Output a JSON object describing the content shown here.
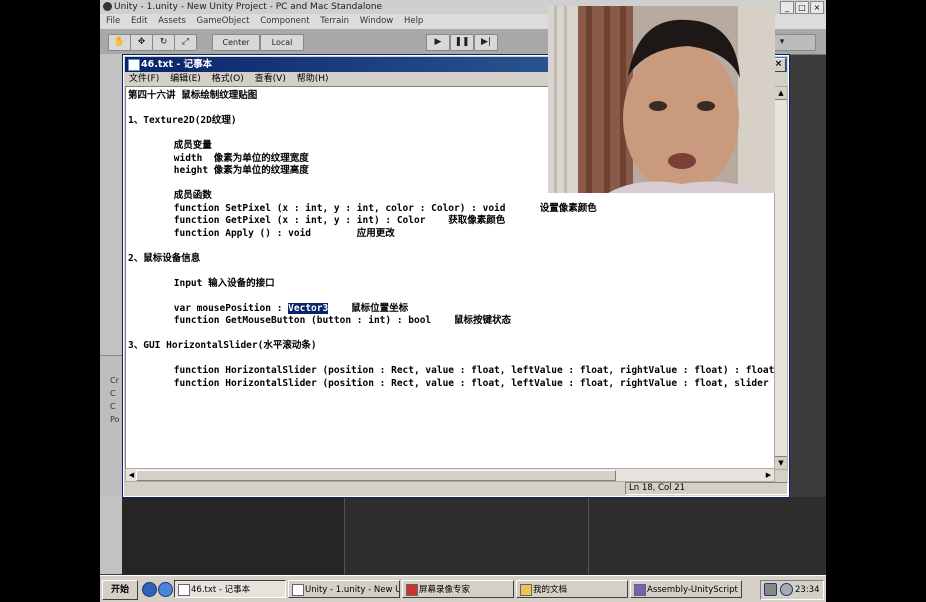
{
  "unity": {
    "title": "Unity - 1.unity - New Unity Project - PC and Mac Standalone",
    "menu": [
      "File",
      "Edit",
      "Assets",
      "GameObject",
      "Component",
      "Terrain",
      "Window",
      "Help"
    ],
    "pivot_center": "Center",
    "pivot_local": "Local",
    "left_panel_labels": [
      "Cr",
      "C",
      "C",
      "Po"
    ]
  },
  "notepad": {
    "title": "46.txt - 记事本",
    "menu": [
      "文件(F)",
      "编辑(E)",
      "格式(O)",
      "查看(V)",
      "帮助(H)"
    ],
    "lines": [
      "第四十六讲 鼠标绘制纹理贴图",
      "",
      "1、Texture2D(2D纹理)",
      "",
      "        成员变量",
      "        width  像素为单位的纹理宽度",
      "        height 像素为单位的纹理高度",
      "",
      "        成员函数",
      "        function SetPixel (x : int, y : int, color : Color) : void      设置像素颜色",
      "        function GetPixel (x : int, y : int) : Color    获取像素颜色",
      "        function Apply () : void        应用更改",
      "",
      "2、鼠标设备信息",
      "",
      "        Input 输入设备的接口",
      "",
      "        var mousePosition : ",
      "        function GetMouseButton (button : int) : bool    鼠标按键状态",
      "",
      "3、GUI HorizontalSlider(水平滚动条)",
      "",
      "        function HorizontalSlider (position : Rect, value : float, leftValue : float, rightValue : float) : float",
      "        function HorizontalSlider (position : Rect, value : float, leftValue : float, rightValue : float, slider :"
    ],
    "selected_text": "Vector3",
    "after_selection": "    鼠标位置坐标",
    "status": "Ln 18, Col 21"
  },
  "taskbar": {
    "start": "开始",
    "tasks": [
      "46.txt - 记事本",
      "Unity - 1.unity - New Uni...",
      "屏幕录像专家",
      "我的文档",
      "Assembly-UnityScript - A..."
    ],
    "clock": "23:34"
  },
  "colors": {
    "title_active": "#0a246a",
    "selection": "#0a246a",
    "window_face": "#d4d0c8"
  }
}
